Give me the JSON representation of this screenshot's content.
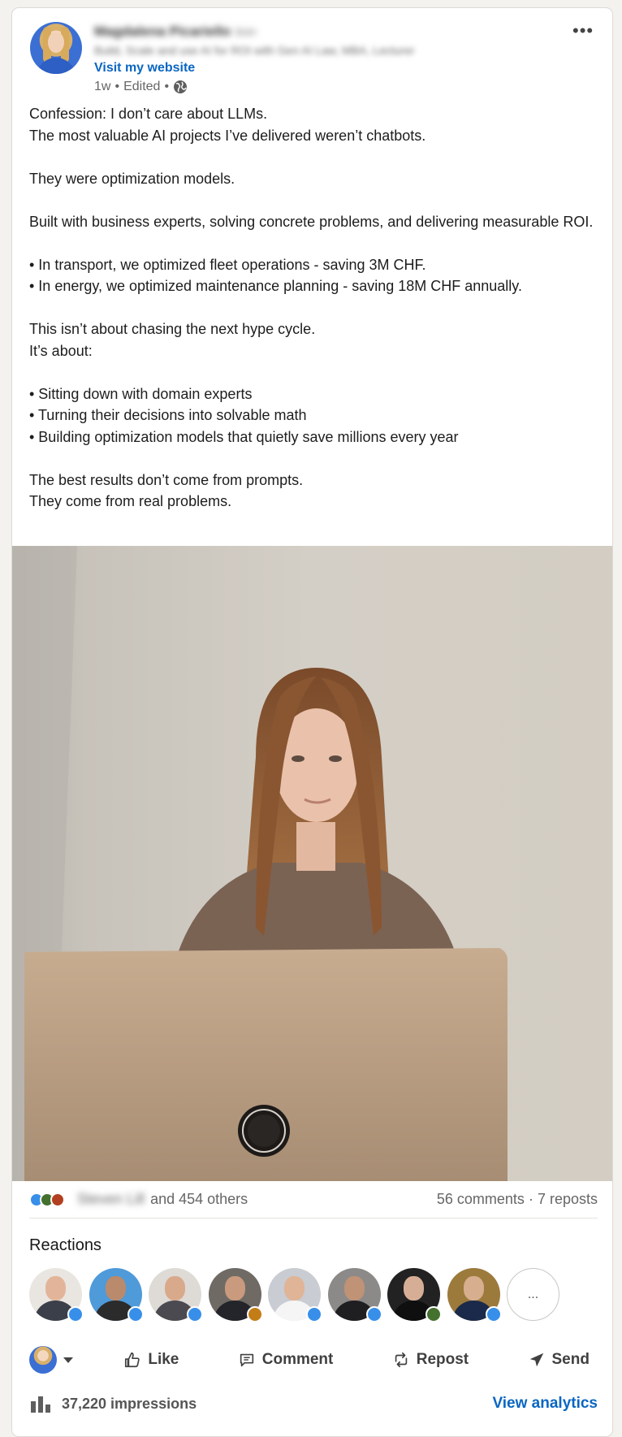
{
  "author": {
    "name": "Magdalena Picariello",
    "badge": "3rd+",
    "headline": "Build, Scale and use AI for ROI with Gen AI Law, MBA, Lecturer",
    "website_label": "Visit my website",
    "time": "1w",
    "edited": "Edited",
    "visibility_icon": "globe-icon"
  },
  "post": {
    "paragraphs": [
      "Confession: I don’t care about LLMs.",
      "The most valuable AI projects I’ve delivered weren’t chatbots.",
      "",
      "They were optimization models.",
      "",
      "Built with business experts, solving concrete problems, and delivering measurable ROI.",
      "",
      "• In transport, we optimized fleet operations - saving 3M CHF.",
      "• In energy, we optimized maintenance planning - saving 18M CHF annually.",
      "",
      "This isn’t about chasing the next hype cycle.",
      "It’s about:",
      "",
      "• Sitting down with domain experts",
      "• Turning their decisions into solvable math",
      "• Building optimization models that quietly save millions every year",
      "",
      "The best results don’t come from prompts.",
      "They come from real problems."
    ]
  },
  "social": {
    "reactor_name": "Steven Lill",
    "others": "and 454 others",
    "comments": "56 comments",
    "separator": "·",
    "reposts": "7 reposts"
  },
  "reactions": {
    "title": "Reactions",
    "more_label": "..."
  },
  "actions": {
    "like": "Like",
    "comment": "Comment",
    "repost": "Repost",
    "send": "Send"
  },
  "stats": {
    "impressions": "37,220 impressions",
    "analytics_label": "View analytics"
  },
  "colors": {
    "link": "#0a66c2",
    "like": "#378fe9",
    "celebrate": "#44712e"
  }
}
